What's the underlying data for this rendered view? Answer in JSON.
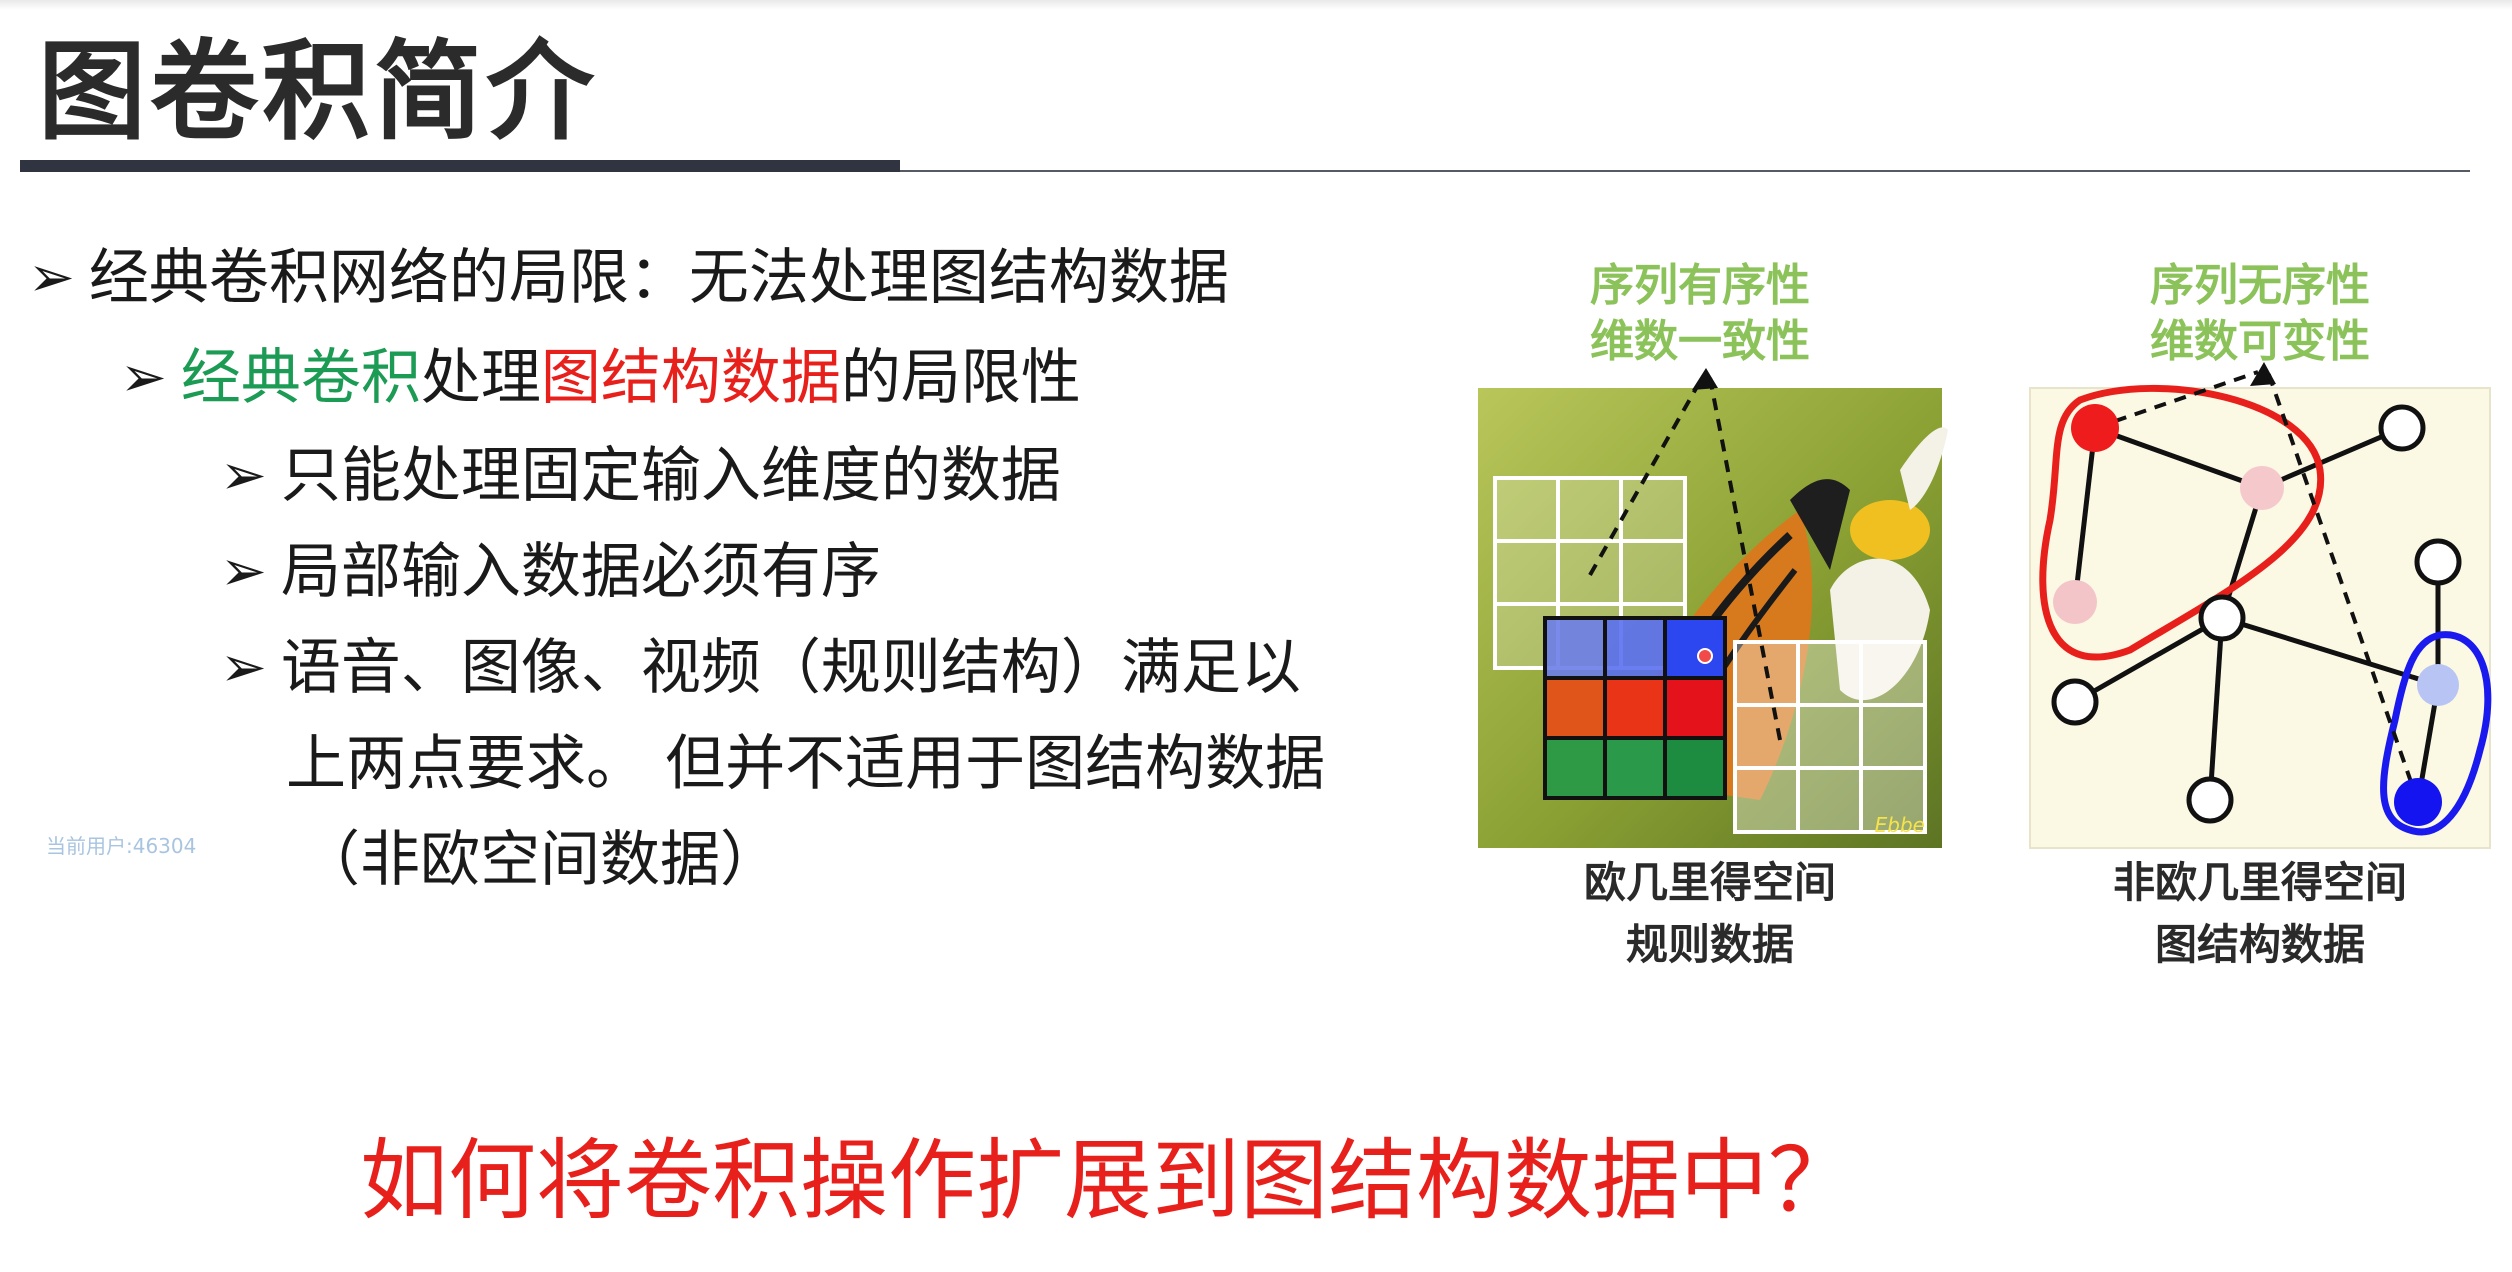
{
  "title": "图卷积简介",
  "bullets": {
    "l0": "经典卷积网络的局限：无法处理图结构数据",
    "l1_green": "经典卷积",
    "l1_mid": "处理",
    "l1_red": "图结构数据",
    "l1_end": "的局限性",
    "l2_a": "只能处理固定输入维度的数据",
    "l2_b": "局部输入数据必须有序",
    "l2_c_1": "语音、图像、视频（规则结构）满足以",
    "l2_c_2": "上两点要求。 但并不适用于图结构数据",
    "l2_c_3": "（非欧空间数据）"
  },
  "arrow_glyph": "➢",
  "watermark": "当前用户:46304",
  "left_figure": {
    "note_1": "序列有序性",
    "note_2": "维数一致性",
    "caption_1": "欧几里得空间",
    "caption_2": "规则数据",
    "photo_corner_text": "Ebbe"
  },
  "right_figure": {
    "note_1": "序列无序性",
    "note_2": "维数可变性",
    "caption_1": "非欧几里得空间",
    "caption_2": "图结构数据"
  },
  "bottom_question": "如何将卷积操作扩展到图结构数据中？",
  "colors": {
    "green_text": "#1c9b54",
    "red_text": "#e8201c",
    "note_green": "#8cc25a",
    "graph_red": "#e8201c",
    "graph_blue": "#1a1aee"
  }
}
